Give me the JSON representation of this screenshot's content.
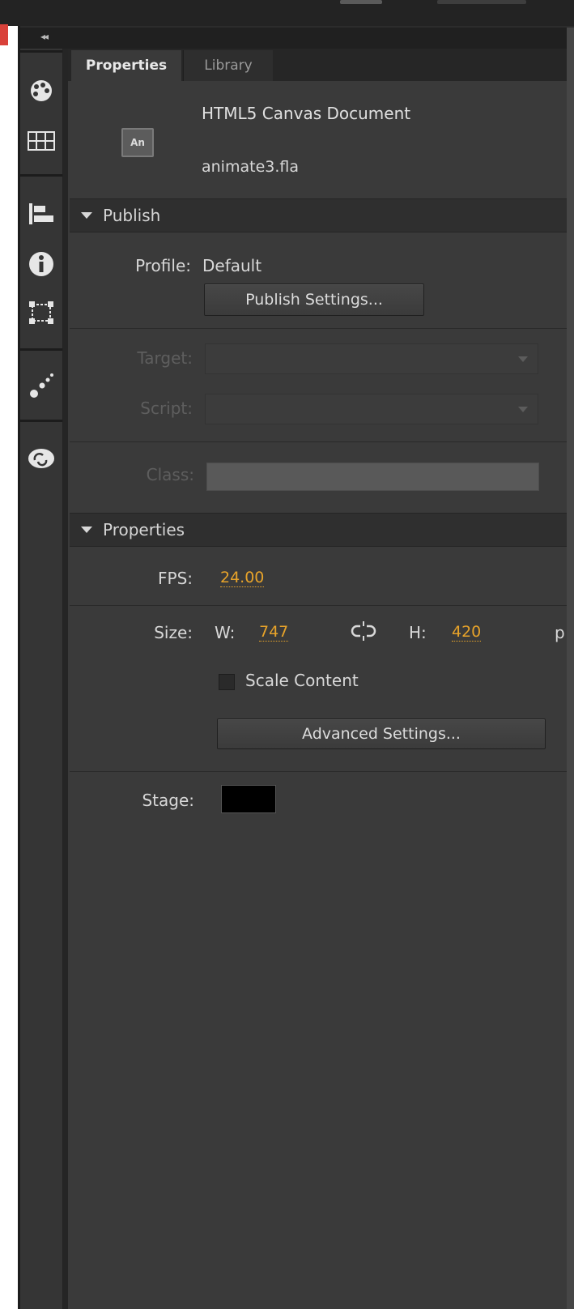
{
  "panel": {
    "tabs": [
      "Properties",
      "Library"
    ],
    "collapse_label": "◂◂",
    "document": {
      "icon_text": "An",
      "type": "HTML5 Canvas Document",
      "filename": "animate3.fla"
    },
    "publish": {
      "section_label": "Publish",
      "profile_label": "Profile:",
      "profile_value": "Default",
      "settings_button": "Publish Settings...",
      "target_label": "Target:",
      "script_label": "Script:",
      "class_label": "Class:"
    },
    "properties": {
      "section_label": "Properties",
      "fps_label": "FPS:",
      "fps_value": "24.00",
      "size_label": "Size:",
      "width_label": "W:",
      "width_value": "747",
      "height_label": "H:",
      "height_value": "420",
      "unit_clipped": "p",
      "scale_content_label": "Scale Content",
      "scale_content_checked": false,
      "advanced_button": "Advanced Settings...",
      "stage_label": "Stage:",
      "stage_color": "#000000"
    }
  },
  "toolbar_icons": [
    "color-wheel-icon",
    "swatches-grid-icon",
    "align-icon",
    "info-icon",
    "transform-icon",
    "motion-presets-icon",
    "cc-libraries-icon"
  ],
  "colors": {
    "panel_bg": "#3a3a3a",
    "header_bg": "#2f2f2f",
    "accent_value": "#e7a32a"
  }
}
